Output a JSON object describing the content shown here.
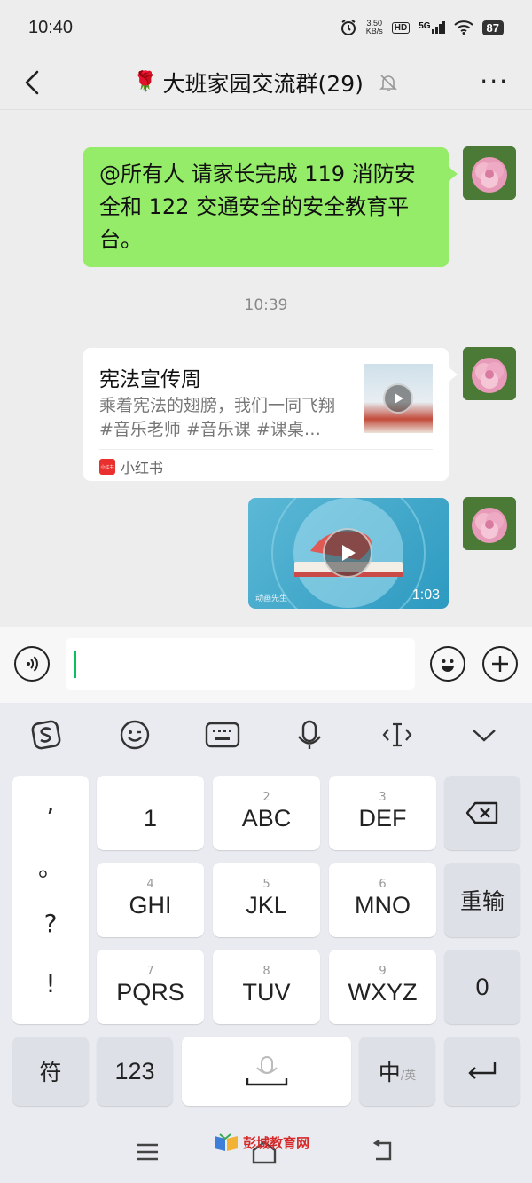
{
  "status_bar": {
    "time": "10:40",
    "net_speed_value": "3.50",
    "net_speed_unit": "KB/s",
    "hd": "HD",
    "signal": "5G",
    "battery": "87"
  },
  "header": {
    "title": "大班家园交流群(29)",
    "title_emoji": "🌹",
    "more": "···"
  },
  "messages": {
    "text_message": "@所有人  请家长完成 119 消防安全和 122 交通安全的安全教育平台。",
    "timestamp": "10:39",
    "link_card": {
      "title": "宪法宣传周",
      "description": "乘着宪法的翅膀，我们一同飞翔#音乐老师 #音乐课 #课桌…",
      "source": "小红书",
      "source_logo_text": "小红书"
    },
    "video": {
      "duration": "1:03",
      "watermark": "动画先生"
    }
  },
  "keyboard": {
    "punct": [
      ",",
      "。",
      "?",
      "!"
    ],
    "keys": [
      {
        "num": "",
        "label": "1"
      },
      {
        "num": "2",
        "label": "ABC"
      },
      {
        "num": "3",
        "label": "DEF"
      },
      {
        "num": "4",
        "label": "GHI"
      },
      {
        "num": "5",
        "label": "JKL"
      },
      {
        "num": "6",
        "label": "MNO"
      },
      {
        "num": "7",
        "label": "PQRS"
      },
      {
        "num": "8",
        "label": "TUV"
      },
      {
        "num": "9",
        "label": "WXYZ"
      }
    ],
    "reinput": "重输",
    "zero": "0",
    "symbol": "符",
    "numbers": "123",
    "lang_main": "中",
    "lang_alt": "/英"
  },
  "watermark_site": "彭城教育网",
  "colors": {
    "chat_bg": "#ededed",
    "my_bubble": "#95ec69",
    "caret": "#07c160",
    "keyboard_bg": "#e9ebf0"
  }
}
